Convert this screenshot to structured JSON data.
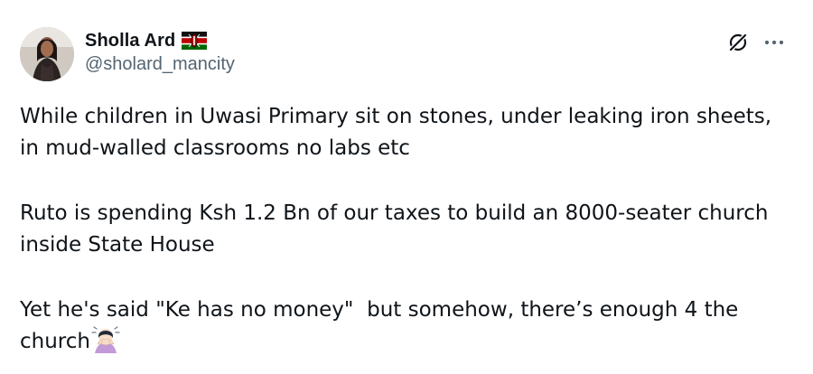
{
  "author": {
    "display_name": "Sholla Ard",
    "handle": "@sholard_mancity",
    "flag_icon": "kenya-flag-icon",
    "avatar_icon": "profile-avatar"
  },
  "actions": {
    "grok_icon": "grok-icon",
    "more_icon": "more-options-icon"
  },
  "tweet": {
    "paragraphs": [
      "While children in Uwasi Primary sit on stones, under leaking iron sheets, in mud-walled classrooms no labs etc",
      "Ruto is spending Ksh 1.2 Bn of our taxes to build an 8000-seater church inside State House",
      "Yet he's said \"Ke has no money\"  but somehow, there’s enough 4 the church"
    ],
    "trailing_emoji": "woman-facepalming-emoji"
  },
  "colors": {
    "text": "#0f1419",
    "secondary": "#536471"
  }
}
